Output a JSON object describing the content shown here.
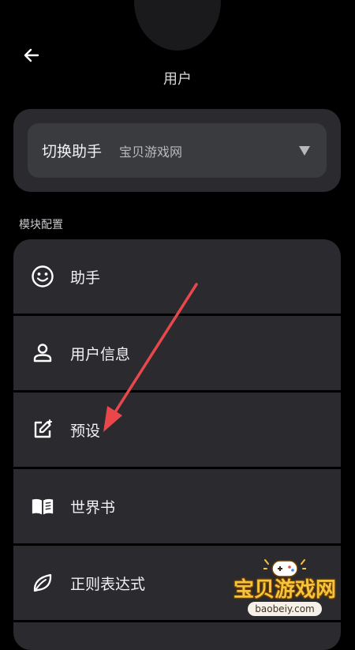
{
  "header": {
    "title": "用户"
  },
  "assistant": {
    "switch_label": "切换助手",
    "selected": "宝贝游戏网"
  },
  "section": {
    "label": "模块配置"
  },
  "modules": [
    {
      "label": "助手",
      "icon": "smiley-icon"
    },
    {
      "label": "用户信息",
      "icon": "person-icon"
    },
    {
      "label": "预设",
      "icon": "edit-icon"
    },
    {
      "label": "世界书",
      "icon": "book-icon"
    },
    {
      "label": "正则表达式",
      "icon": "leaf-icon"
    }
  ],
  "watermark": {
    "title": "宝贝游戏网",
    "url": "baobeiy.com"
  },
  "colors": {
    "background": "#000000",
    "card": "#2b2b2f",
    "select": "#3a3b3f",
    "annotation": "#e8474c"
  }
}
